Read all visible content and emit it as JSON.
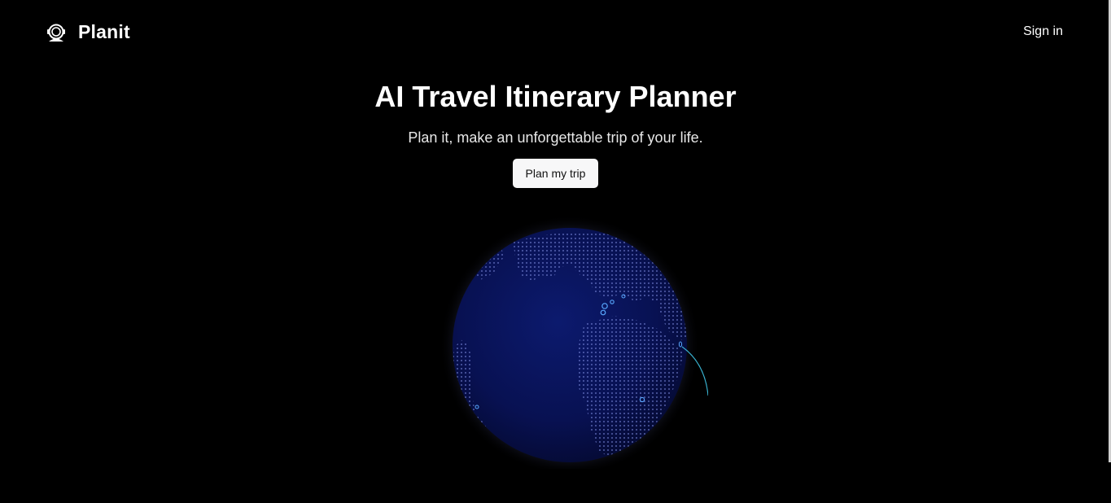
{
  "nav": {
    "brand_name": "Planit",
    "brand_icon": "astronaut-helmet-icon",
    "signin_label": "Sign in"
  },
  "hero": {
    "title": "AI Travel Itinerary Planner",
    "subtitle": "Plan it, make an unforgettable trip of your life.",
    "cta_label": "Plan my trip"
  },
  "globe": {
    "icon": "globe-icon"
  },
  "colors": {
    "background": "#000000",
    "globe_fill": "#0a1250",
    "globe_dots": "#6f7fd6",
    "arc": "#3fc6e8",
    "button_bg": "#f7f7f8"
  }
}
